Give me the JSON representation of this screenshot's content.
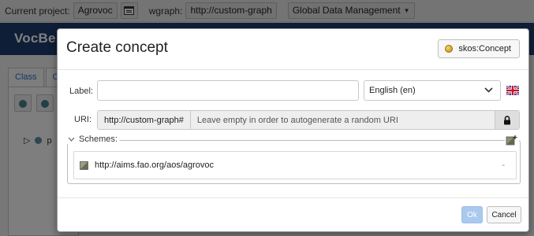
{
  "topbar": {
    "project_label": "Current project:",
    "project_value": "Agrovoc",
    "wgraph_label": "wgraph:",
    "wgraph_value": "http://custom-graph",
    "dataset_value": "Global Data Management"
  },
  "app": {
    "brand": "VocBe",
    "tabs": [
      "Class",
      "C"
    ],
    "tree_item": "p"
  },
  "modal": {
    "title": "Create concept",
    "type_button": "skos:Concept",
    "label_caption": "Label:",
    "label_value": "",
    "language": "English (en)",
    "uri_caption": "URI:",
    "uri_prefix": "http://custom-graph#",
    "uri_placeholder": "Leave empty in order to autogenerate a random URI",
    "schemes_caption": "Schemes:",
    "schemes": [
      "http://aims.fao.org/aos/agrovoc"
    ],
    "scheme_remove_symbol": "-",
    "ok_label": "Ok",
    "cancel_label": "Cancel"
  },
  "colors": {
    "brand_bar": "#1f3d6e",
    "ok_disabled": "#a9c9ee",
    "link": "#2a6cc7"
  },
  "icons": {
    "project_settings": "window-icon",
    "type_dot": "gold-dot-icon",
    "language_flag": "uk-flag-icon",
    "lock": "lock-icon",
    "scheme": "scheme-icon",
    "add_scheme": "add-scheme-icon",
    "collapse": "chevron-down-icon"
  }
}
